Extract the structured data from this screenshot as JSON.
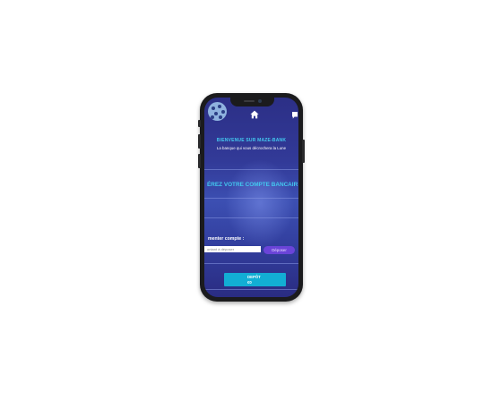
{
  "header": {
    "logo_icon": "moon-logo-icon",
    "home_icon": "home-icon",
    "menu_icon": "chat-icon"
  },
  "welcome": {
    "title": "BIENVENUE SUR MAZE-BANK",
    "subtitle": "La banque qui vous décrochera la Lune"
  },
  "account": {
    "title": "ÉREZ VOTRE COMPTE BANCAIR"
  },
  "deposit": {
    "label": "menter compte :",
    "input_placeholder": "ontant à déposer",
    "input_value": "",
    "button_label": "Déposer"
  },
  "summary": {
    "title": "DEPÔT",
    "value": "€0"
  },
  "colors": {
    "accent_cyan": "#43c9f0",
    "button_purple": "#6a44d8",
    "card_cyan": "#12aed4",
    "screen_bg": "#323a98"
  }
}
